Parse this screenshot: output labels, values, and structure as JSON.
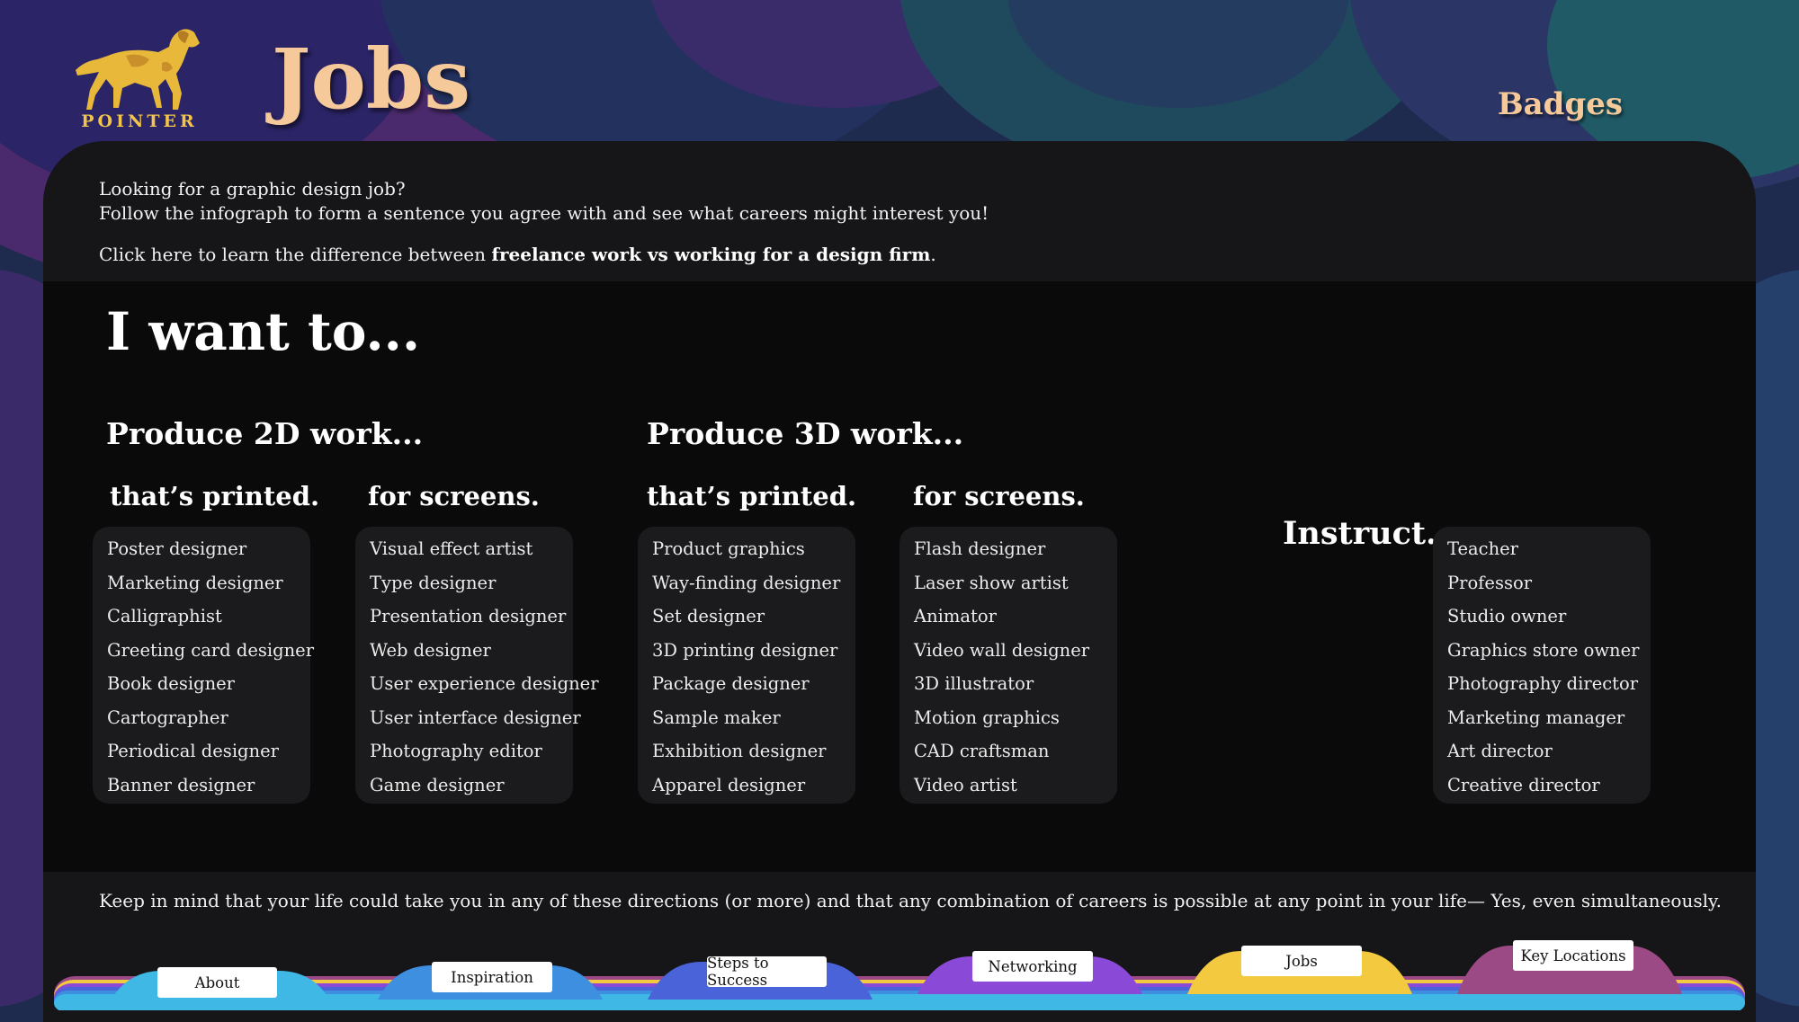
{
  "brand": {
    "name": "POINTER",
    "logo_icon": "pointer-dog-logo"
  },
  "page_title": "Jobs",
  "badges_link": "Badges",
  "intro": {
    "line1": "Looking for a graphic design job?",
    "line2": "Follow the infograph to form a sentence you agree with and see what careers might interest you!",
    "link_prefix": "Click here to learn the difference between ",
    "link_bold": "freelance work vs working for a design firm",
    "link_suffix": "."
  },
  "headline": "I want to...",
  "sections": {
    "produce_2d": "Produce 2D work...",
    "produce_3d": "Produce 3D work..."
  },
  "columns": {
    "2d_printed": {
      "title": "that’s printed.",
      "items": [
        "Poster designer",
        "Marketing designer",
        "Calligraphist",
        "Greeting card designer",
        "Book designer",
        "Cartographer",
        "Periodical designer",
        "Banner designer"
      ]
    },
    "2d_screens": {
      "title": "for screens.",
      "items": [
        "Visual effect artist",
        "Type designer",
        "Presentation designer",
        "Web designer",
        "User experience designer",
        "User interface designer",
        "Photography editor",
        "Game designer"
      ]
    },
    "3d_printed": {
      "title": "that’s printed.",
      "items": [
        "Product graphics",
        "Way-finding designer",
        "Set designer",
        "3D printing designer",
        "Package designer",
        "Sample maker",
        "Exhibition designer",
        "Apparel designer"
      ]
    },
    "3d_screens": {
      "title": "for screens.",
      "items": [
        "Flash designer",
        "Laser show artist",
        "Animator",
        "Video wall designer",
        "3D illustrator",
        "Motion graphics",
        "CAD craftsman",
        "Video artist"
      ]
    },
    "instruct": {
      "title": "Instruct.",
      "items": [
        "Teacher",
        "Professor",
        "Studio owner",
        "Graphics store owner",
        "Photography director",
        "Marketing manager",
        "Art director",
        "Creative director"
      ]
    }
  },
  "note": "Keep in mind that your life could take you in any of these directions (or more) and that any combination of careers is possible at any point in your life— Yes, even simultaneously.",
  "nav_tabs": [
    {
      "label": "About",
      "color": "#3fb8e6"
    },
    {
      "label": "Inspiration",
      "color": "#3f8fe0"
    },
    {
      "label": "Steps to Success",
      "color": "#4a63d8"
    },
    {
      "label": "Networking",
      "color": "#8a49d6"
    },
    {
      "label": "Jobs",
      "color": "#f3c940"
    },
    {
      "label": "Key Locations",
      "color": "#9c4a86"
    }
  ],
  "colors": {
    "title": "#f6c99a",
    "brand": "#f2c44a",
    "panel": "#161618",
    "chart_bg": "#0a0a0b",
    "list_bg": "#1b1b1d"
  }
}
